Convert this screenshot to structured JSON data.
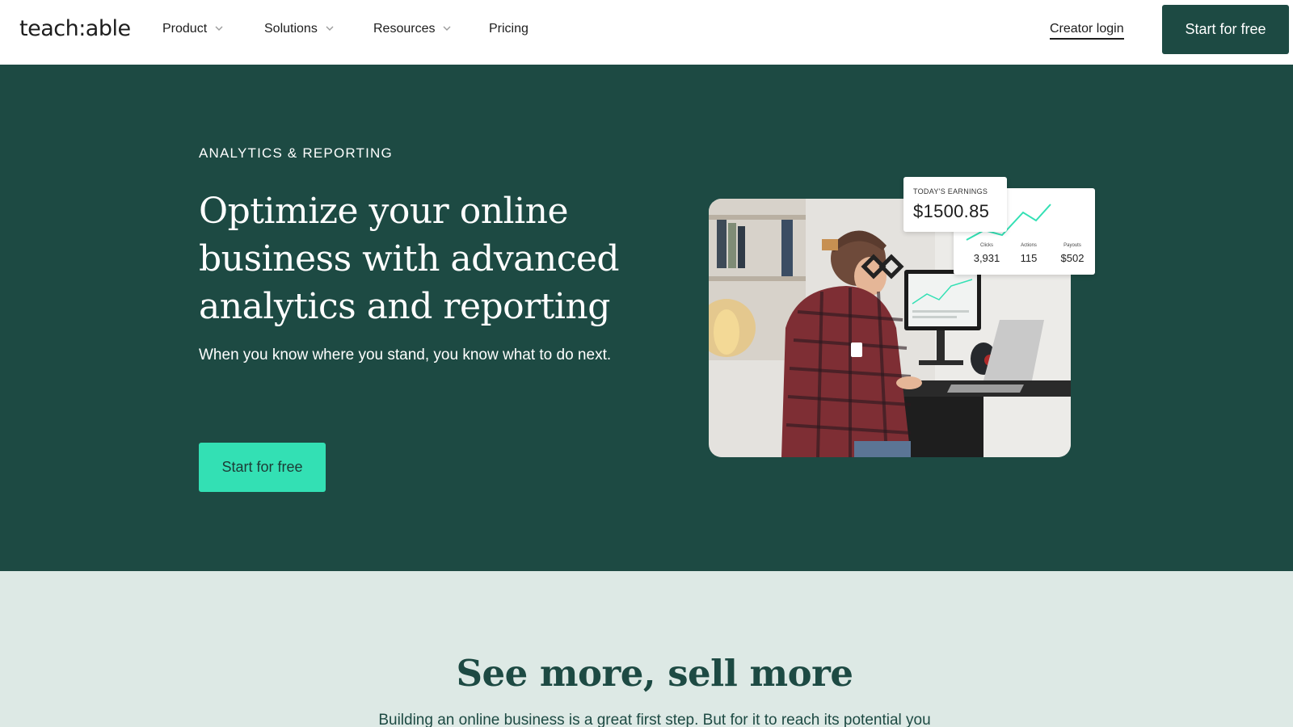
{
  "nav": {
    "logo": "teach:able",
    "items": [
      {
        "label": "Product",
        "has_dropdown": true
      },
      {
        "label": "Solutions",
        "has_dropdown": true
      },
      {
        "label": "Resources",
        "has_dropdown": true
      },
      {
        "label": "Pricing",
        "has_dropdown": false
      }
    ],
    "login_label": "Creator login",
    "cta_label": "Start for free",
    "dropdown_icon": "chevron-down-icon"
  },
  "hero": {
    "eyebrow": "ANALYTICS & REPORTING",
    "headline": "Optimize your online business with advanced analytics and reporting",
    "subtext": "When you know where you stand, you know what to do next.",
    "cta_label": "Start for free",
    "earnings_card": {
      "label": "TODAY'S EARNINGS",
      "value": "$1500.85"
    },
    "stats": [
      {
        "label": "Clicks",
        "value": "3,931"
      },
      {
        "label": "Actions",
        "value": "115"
      },
      {
        "label": "Payouts",
        "value": "$502"
      }
    ]
  },
  "section2": {
    "title": "See more, sell more",
    "body": "Building an online business is a great first step. But for it to reach its potential you"
  },
  "colors": {
    "brand_dark": "#1d4a43",
    "accent": "#33e0b4",
    "section_bg": "#dde9e5",
    "sparkline": "#33e0b4"
  }
}
